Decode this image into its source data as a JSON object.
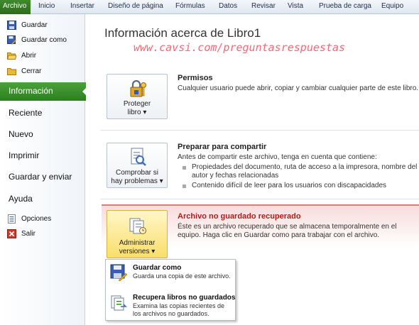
{
  "ribbon": {
    "file_tab": "Archivo",
    "tabs": [
      "Inicio",
      "Insertar",
      "Diseño de página",
      "Fórmulas",
      "Datos",
      "Revisar",
      "Vista",
      "Prueba de carga",
      "Equipo"
    ]
  },
  "nav": {
    "save": "Guardar",
    "save_as": "Guardar como",
    "open": "Abrir",
    "close": "Cerrar",
    "info": "Información",
    "recent": "Reciente",
    "new": "Nuevo",
    "print": "Imprimir",
    "save_send": "Guardar y enviar",
    "help": "Ayuda",
    "options": "Opciones",
    "exit": "Salir"
  },
  "main": {
    "title": "Información acerca de Libro1",
    "watermark": "www.cavsi.com/preguntasrespuestas",
    "permissions": {
      "button_line1": "Proteger",
      "button_line2": "libro ▾",
      "heading": "Permisos",
      "text": "Cualquier usuario puede abrir, copiar y cambiar cualquier parte de este libro."
    },
    "share": {
      "button_line1": "Comprobar si",
      "button_line2": "hay problemas ▾",
      "heading": "Preparar para compartir",
      "text": "Antes de compartir este archivo, tenga en cuenta que contiene:",
      "bullet1": "Propiedades del documento, ruta de acceso a la impresora, nombre del autor y fechas relacionadas",
      "bullet2": "Contenido difícil de leer para los usuarios con discapacidades"
    },
    "recovered": {
      "button_line1": "Administrar",
      "button_line2": "versiones ▾",
      "heading": "Archivo no guardado recuperado",
      "text": "Éste es un archivo recuperado que se almacena temporalmente en el equipo. Haga clic en Guardar como para trabajar con el archivo."
    }
  },
  "menu": {
    "save_as_title": "Guardar como",
    "save_as_desc": "Guarda una copia de este archivo.",
    "recover_title": "Recupera libros no guardados",
    "recover_desc": "Examina las copias recientes de los archivos no guardados."
  },
  "colors": {
    "file_tab": "#2e6b1e",
    "active_nav": "#3f922f",
    "alert_heading": "#b51a1a",
    "watermark": "#f06a78"
  }
}
